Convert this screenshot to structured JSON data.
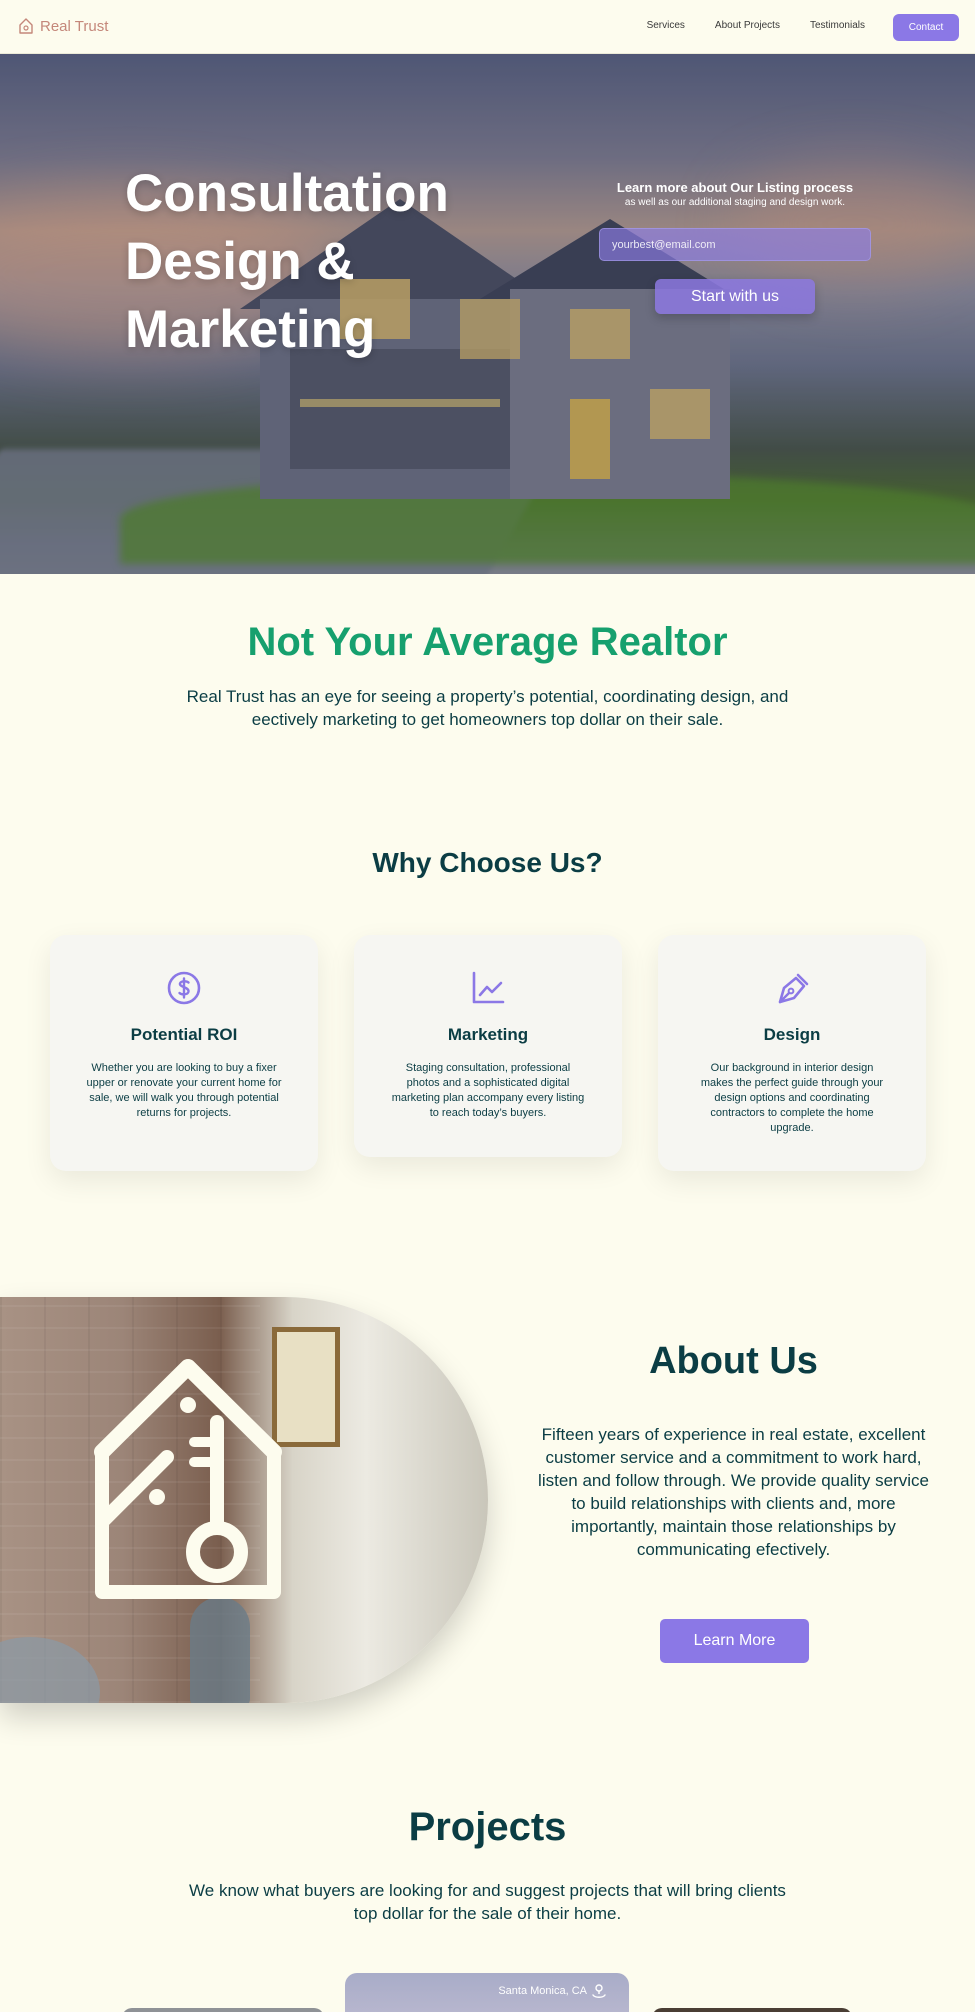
{
  "nav": {
    "brand": "Real Trust",
    "links": [
      "Services",
      "About Projects",
      "Testimonials"
    ],
    "contact": "Contact"
  },
  "hero": {
    "title_lines": [
      "Consultation",
      "Design &",
      "Marketing"
    ],
    "form_lead": "Learn more about Our Listing process",
    "form_sub": "as well as our additional staging and design work.",
    "email_placeholder": "yourbest@email.com",
    "cta": "Start with us"
  },
  "intro": {
    "title": "Not Your Average Realtor",
    "text": "Real Trust has an eye for seeing a property’s potential, coordinating design, and eectively marketing to get homeowners top dollar on their sale."
  },
  "why": {
    "title": "Why Choose Us?",
    "cards": [
      {
        "icon": "dollar-circle-icon",
        "title": "Potential ROI",
        "text": "Whether you are looking to buy a fixer upper or renovate your current home for sale, we will walk you through potential returns for projects."
      },
      {
        "icon": "line-chart-icon",
        "title": "Marketing",
        "text": "Staging consultation, professional photos and a sophisticated digital marketing  plan accompany every listing to reach today’s buyers."
      },
      {
        "icon": "pen-nib-icon",
        "title": "Design",
        "text": "Our background in interior design makes the perfect guide through your design options and coordinating contractors to complete the home upgrade."
      }
    ]
  },
  "about": {
    "title": "About Us",
    "text": "Fifteen years of experience in real estate, excellent customer service and a commitment to work hard, listen and follow through. We provide quality service to build relationships with clients and, more importantly, maintain those relationships by communicating efectively.",
    "button": "Learn More"
  },
  "projects": {
    "title": "Projects",
    "text": "We know what buyers are looking for and suggest projects that will bring clients top dollar for the sale of their home.",
    "featured_location": "Santa Monica, CA"
  },
  "colors": {
    "accent": "#8b78e6",
    "green": "#16a06e",
    "dark": "#0b3d44",
    "background": "#fdfcee",
    "brand": "#c4877a"
  }
}
